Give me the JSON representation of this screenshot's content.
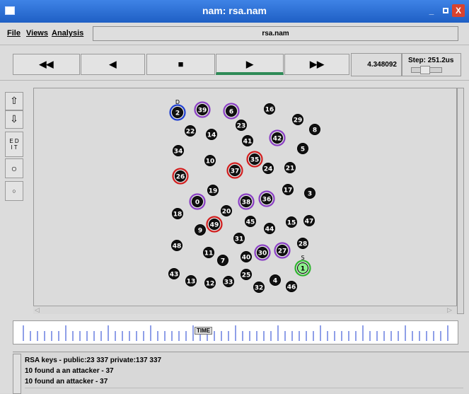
{
  "window": {
    "title": "nam: rsa.nam"
  },
  "menu": {
    "file": "File",
    "views": "Views",
    "analysis": "Analysis"
  },
  "filename": "rsa.nam",
  "toolbar": {
    "rewind_fast": "◀◀",
    "rewind": "◀",
    "stop": "■",
    "play": "▶",
    "fast_forward": "▶▶",
    "time": "4.348092",
    "step_label": "Step: 251.2us"
  },
  "left_tools": {
    "edit": "E D\nI T"
  },
  "timeline": {
    "label": "TIME"
  },
  "log": {
    "lines": [
      "RSA keys - public:23 337 private:137 337",
      "10 found a an attacker - 37",
      "10 found an attacker - 37"
    ]
  },
  "nodes": [
    {
      "label": "2",
      "ring": "blue",
      "tag": "D"
    },
    {
      "label": "39",
      "ring": "purple"
    },
    {
      "label": "6",
      "ring": "purple"
    },
    {
      "label": "16",
      "ring": "black"
    },
    {
      "label": "29",
      "ring": "black"
    },
    {
      "label": "8",
      "ring": "black"
    },
    {
      "label": "22",
      "ring": "black"
    },
    {
      "label": "14",
      "ring": "black"
    },
    {
      "label": "23",
      "ring": "black"
    },
    {
      "label": "41",
      "ring": "black"
    },
    {
      "label": "42",
      "ring": "purple"
    },
    {
      "label": "5",
      "ring": "black"
    },
    {
      "label": "34",
      "ring": "black"
    },
    {
      "label": "10",
      "ring": "black"
    },
    {
      "label": "37",
      "ring": "red"
    },
    {
      "label": "35",
      "ring": "red"
    },
    {
      "label": "24",
      "ring": "black"
    },
    {
      "label": "21",
      "ring": "black"
    },
    {
      "label": "26",
      "ring": "red"
    },
    {
      "label": "19",
      "ring": "black"
    },
    {
      "label": "17",
      "ring": "black"
    },
    {
      "label": "3",
      "ring": "black"
    },
    {
      "label": "0",
      "ring": "purple"
    },
    {
      "label": "38",
      "ring": "purple"
    },
    {
      "label": "36",
      "ring": "purple"
    },
    {
      "label": "18",
      "ring": "black"
    },
    {
      "label": "20",
      "ring": "black"
    },
    {
      "label": "45",
      "ring": "black"
    },
    {
      "label": "15",
      "ring": "black"
    },
    {
      "label": "47",
      "ring": "black"
    },
    {
      "label": "9",
      "ring": "black"
    },
    {
      "label": "49",
      "ring": "red"
    },
    {
      "label": "44",
      "ring": "black"
    },
    {
      "label": "31",
      "ring": "black"
    },
    {
      "label": "28",
      "ring": "black"
    },
    {
      "label": "48",
      "ring": "black"
    },
    {
      "label": "11",
      "ring": "black"
    },
    {
      "label": "7",
      "ring": "black"
    },
    {
      "label": "40",
      "ring": "black"
    },
    {
      "label": "30",
      "ring": "purple"
    },
    {
      "label": "27",
      "ring": "purple"
    },
    {
      "label": "1",
      "ring": "green",
      "tag": "S"
    },
    {
      "label": "43",
      "ring": "black"
    },
    {
      "label": "13",
      "ring": "black"
    },
    {
      "label": "12",
      "ring": "black"
    },
    {
      "label": "33",
      "ring": "black"
    },
    {
      "label": "25",
      "ring": "black"
    },
    {
      "label": "32",
      "ring": "black"
    },
    {
      "label": "4",
      "ring": "black"
    },
    {
      "label": "46",
      "ring": "black"
    }
  ],
  "colors": {
    "blue": "#1f3fd0",
    "purple": "#8a3fc4",
    "red": "#d21e1e",
    "green": "#2fb52f",
    "black": "#000000"
  }
}
